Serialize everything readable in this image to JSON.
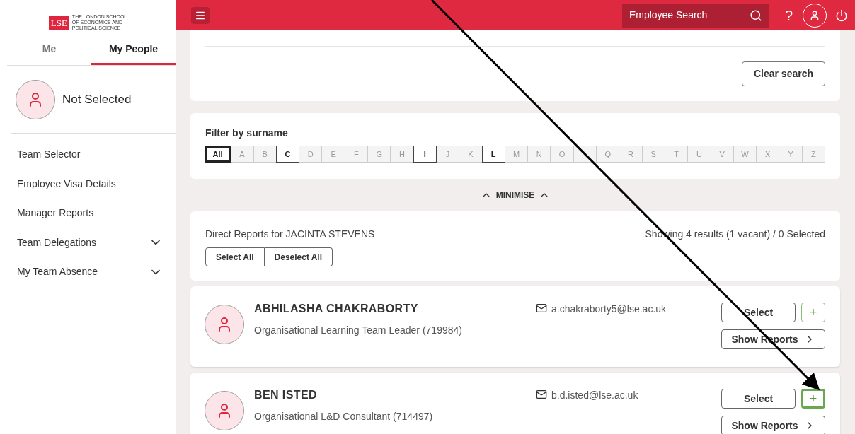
{
  "logo": {
    "mark": "LSE",
    "lines": [
      "THE LONDON SCHOOL",
      "OF ECONOMICS AND",
      "POLITICAL SCIENCE"
    ]
  },
  "sidebar_tabs": [
    {
      "label": "Me",
      "selected": false
    },
    {
      "label": "My People",
      "selected": true
    }
  ],
  "selected_person": {
    "label": "Not Selected"
  },
  "sidebar_items": [
    {
      "label": "Team Selector",
      "expandable": false
    },
    {
      "label": "Employee Visa Details",
      "expandable": false
    },
    {
      "label": "Manager Reports",
      "expandable": false
    },
    {
      "label": "Team Delegations",
      "expandable": true
    },
    {
      "label": "My Team Absence",
      "expandable": true
    }
  ],
  "header": {
    "search_placeholder": "Employee Search",
    "help": "?"
  },
  "search_card": {
    "clear_button": "Clear search"
  },
  "filter": {
    "title": "Filter by surname",
    "letters": [
      {
        "label": "All",
        "selected": true,
        "enabled": true
      },
      {
        "label": "A",
        "selected": false,
        "enabled": false
      },
      {
        "label": "B",
        "selected": false,
        "enabled": false
      },
      {
        "label": "C",
        "selected": false,
        "enabled": true
      },
      {
        "label": "D",
        "selected": false,
        "enabled": false
      },
      {
        "label": "E",
        "selected": false,
        "enabled": false
      },
      {
        "label": "F",
        "selected": false,
        "enabled": false
      },
      {
        "label": "G",
        "selected": false,
        "enabled": false
      },
      {
        "label": "H",
        "selected": false,
        "enabled": false
      },
      {
        "label": "I",
        "selected": false,
        "enabled": true
      },
      {
        "label": "J",
        "selected": false,
        "enabled": false
      },
      {
        "label": "K",
        "selected": false,
        "enabled": false
      },
      {
        "label": "L",
        "selected": false,
        "enabled": true
      },
      {
        "label": "M",
        "selected": false,
        "enabled": false
      },
      {
        "label": "N",
        "selected": false,
        "enabled": false
      },
      {
        "label": "O",
        "selected": false,
        "enabled": false
      },
      {
        "selected": false,
        "enabled": false
      },
      {
        "label": "Q",
        "selected": false,
        "enabled": false
      },
      {
        "label": "R",
        "selected": false,
        "enabled": false
      },
      {
        "label": "S",
        "selected": false,
        "enabled": false
      },
      {
        "label": "T",
        "selected": false,
        "enabled": false
      },
      {
        "label": "U",
        "selected": false,
        "enabled": false
      },
      {
        "label": "V",
        "selected": false,
        "enabled": false
      },
      {
        "label": "W",
        "selected": false,
        "enabled": false
      },
      {
        "label": "X",
        "selected": false,
        "enabled": false
      },
      {
        "label": "Y",
        "selected": false,
        "enabled": false
      },
      {
        "label": "Z",
        "selected": false,
        "enabled": false
      }
    ],
    "minimise": "MINIMISE"
  },
  "reports": {
    "title": "Direct Reports for JACINTA STEVENS",
    "summary": "Showing 4 results (1 vacant) / 0 Selected",
    "select_all": "Select All",
    "deselect_all": "Deselect All"
  },
  "people": [
    {
      "name": "ABHILASHA CHAKRABORTY",
      "role": "Organisational Learning Team Leader (719984)",
      "email": "a.chakraborty5@lse.ac.uk",
      "select": "Select",
      "show_reports": "Show Reports",
      "add": "+",
      "focused": false
    },
    {
      "name": "BEN ISTED",
      "role": "Organisational L&D Consultant (714497)",
      "email": "b.d.isted@lse.ac.uk",
      "select": "Select",
      "show_reports": "Show Reports",
      "add": "+",
      "focused": true
    }
  ]
}
